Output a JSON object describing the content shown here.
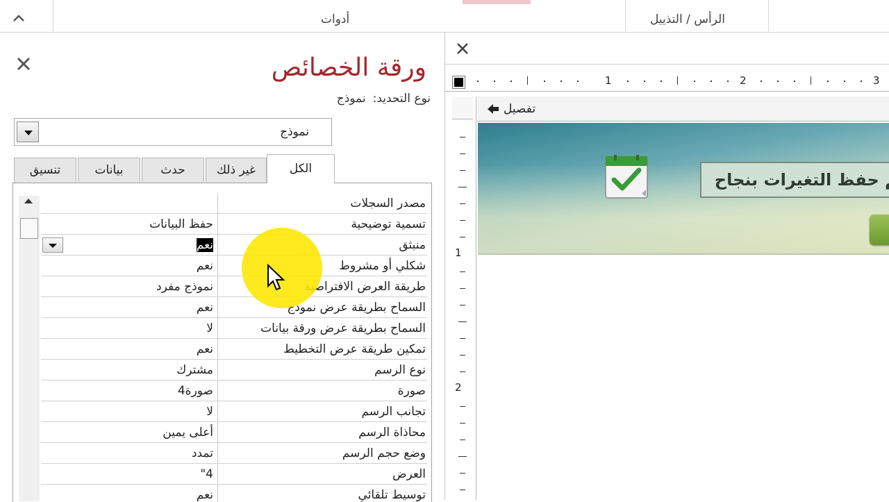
{
  "ribbon": {
    "group_tools": "أدوات",
    "group_header_footer": "الرأس / التذييل"
  },
  "property_sheet": {
    "title": "ورقة الخصائص",
    "selection_type_label": "نوع التحديد:",
    "selection_type_value": "نموذج",
    "object_select_value": "نموذج",
    "tabs": [
      {
        "label": "تنسيق",
        "active": false
      },
      {
        "label": "بيانات",
        "active": false
      },
      {
        "label": "حدث",
        "active": false
      },
      {
        "label": "غير ذلك",
        "active": false
      },
      {
        "label": "الكل",
        "active": true
      }
    ],
    "rows": [
      {
        "name": "مصدر السجلات",
        "value": ""
      },
      {
        "name": "تسمية توضيحية",
        "value": "حفظ البيانات"
      },
      {
        "name": "منبثق",
        "value": "نعم"
      },
      {
        "name": "شكلي أو مشروط",
        "value": "نعم"
      },
      {
        "name": "طريقة العرض الافتراضية",
        "value": "نموذج مفرد"
      },
      {
        "name": "السماح بطريقة عرض نموذج",
        "value": "نعم"
      },
      {
        "name": "السماح بطريقة عرض ورقة بيانات",
        "value": "لا"
      },
      {
        "name": "تمكين طريقة عرض التخطيط",
        "value": "نعم"
      },
      {
        "name": "نوع الرسم",
        "value": "مشترك"
      },
      {
        "name": "صورة",
        "value": "صورة4"
      },
      {
        "name": "تجانب الرسم",
        "value": "لا"
      },
      {
        "name": "محاذاة الرسم",
        "value": "أعلى يمين"
      },
      {
        "name": "وضع حجم الرسم",
        "value": "تمدد"
      },
      {
        "name": "العرض",
        "value": "4\""
      },
      {
        "name": "توسيط تلقائي",
        "value": "نعم"
      }
    ]
  },
  "design": {
    "ruler_numbers": [
      "1",
      "2",
      "3"
    ],
    "vruler_numbers": [
      "1",
      "2"
    ],
    "section_label": "تفصيل",
    "message_label": "تم حفظ التغيرات بنجاح"
  },
  "colors": {
    "title_red": "#a4262c",
    "highlight_yellow": "#ffe600",
    "check_green": "#3a9b3a"
  }
}
